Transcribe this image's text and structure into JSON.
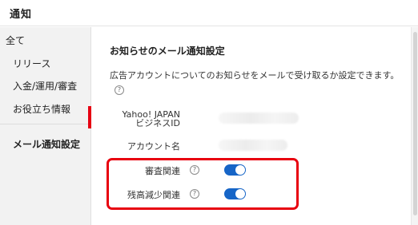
{
  "window": {
    "title": "通知"
  },
  "sidebar": {
    "items": [
      {
        "label": "全て"
      },
      {
        "label": "リリース"
      },
      {
        "label": "入金/運用/審査"
      },
      {
        "label": "お役立ち情報"
      },
      {
        "label": "メール通知設定",
        "selected": true
      }
    ]
  },
  "main": {
    "heading": "お知らせのメール通知設定",
    "description": "広告アカウントについてのお知らせをメールで受け取るか設定できます。",
    "fields": {
      "business_id_line1": "Yahoo! JAPAN",
      "business_id_line2": "ビジネスID",
      "account_name_label": "アカウント名"
    },
    "toggles": [
      {
        "label": "審査関連",
        "on": true
      },
      {
        "label": "残高減少関連",
        "on": true
      }
    ]
  },
  "icons": {
    "help": "?"
  },
  "colors": {
    "accent": "#e60012",
    "toggle_on": "#1665c7"
  }
}
